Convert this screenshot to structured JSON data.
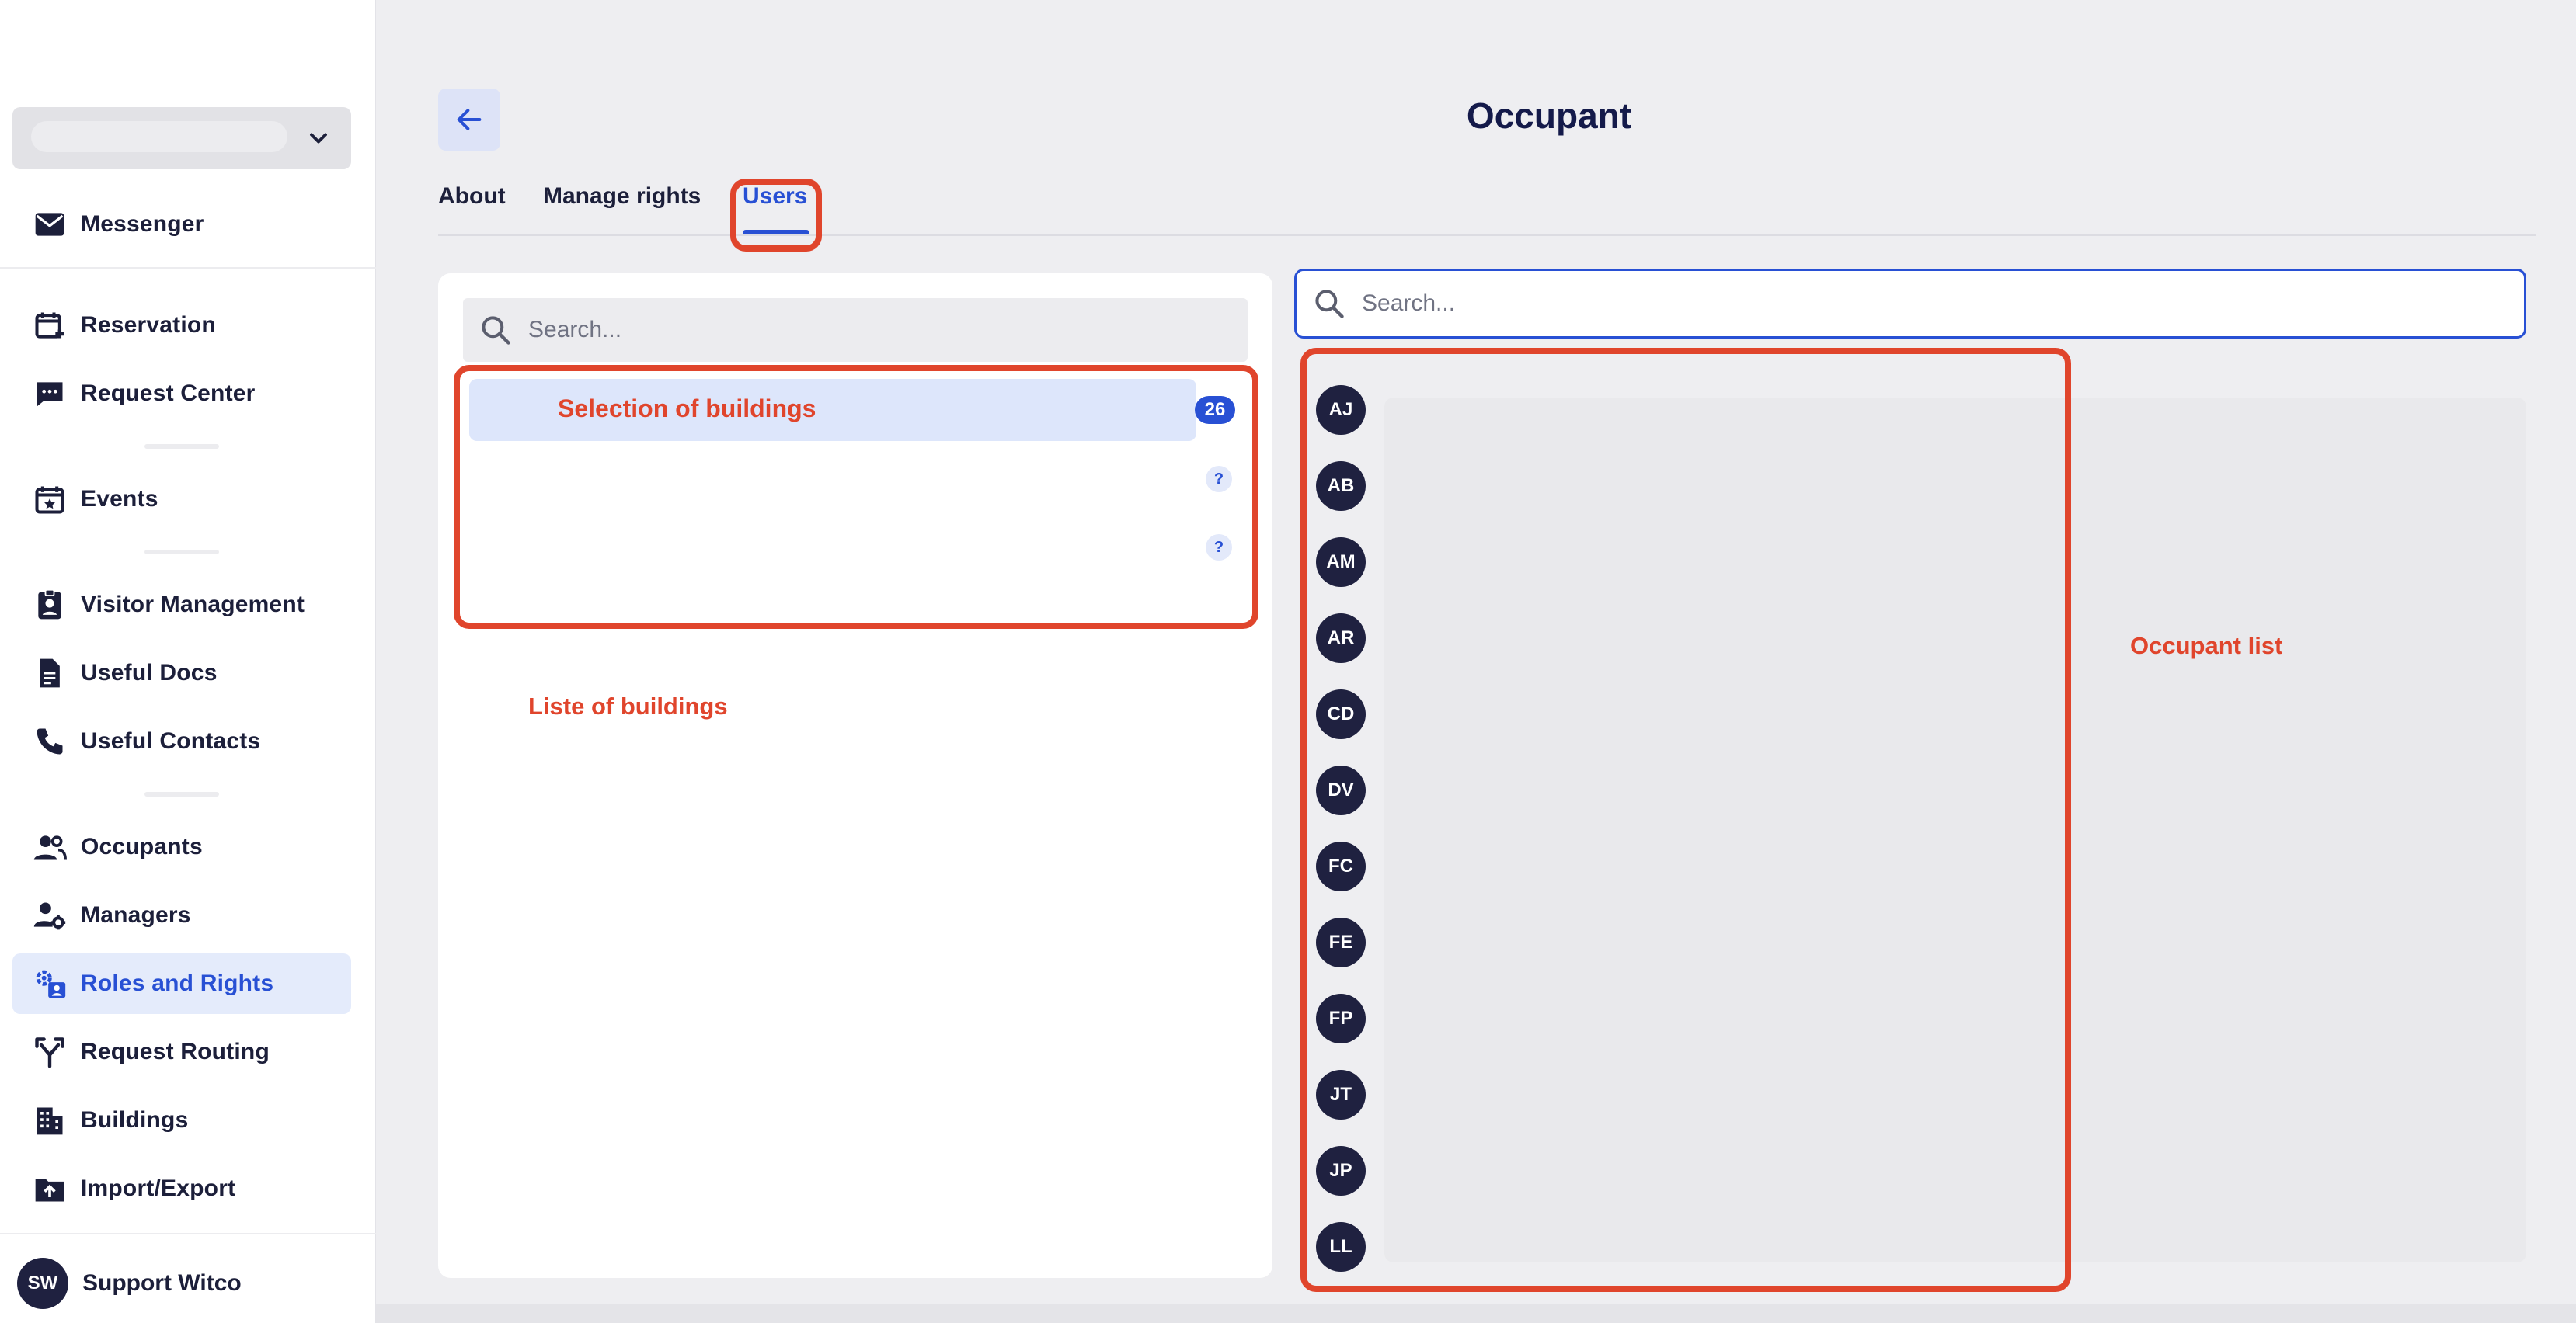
{
  "sidebar": {
    "items": [
      {
        "label": "Messenger",
        "icon": "mail-icon"
      },
      {
        "label": "Reservation",
        "icon": "calendar-plus-icon"
      },
      {
        "label": "Request Center",
        "icon": "chat-icon"
      },
      {
        "label": "Events",
        "icon": "calendar-star-icon"
      },
      {
        "label": "Visitor Management",
        "icon": "badge-icon"
      },
      {
        "label": "Useful Docs",
        "icon": "document-icon"
      },
      {
        "label": "Useful Contacts",
        "icon": "phone-icon"
      },
      {
        "label": "Occupants",
        "icon": "people-icon"
      },
      {
        "label": "Managers",
        "icon": "user-gear-icon"
      },
      {
        "label": "Roles and Rights",
        "icon": "roles-icon",
        "active": true
      },
      {
        "label": "Request Routing",
        "icon": "routing-icon"
      },
      {
        "label": "Buildings",
        "icon": "building-icon"
      },
      {
        "label": "Import/Export",
        "icon": "upload-folder-icon"
      }
    ],
    "user": {
      "initials": "SW",
      "name": "Support Witco"
    }
  },
  "header": {
    "title": "Occupant"
  },
  "tabs": [
    {
      "label": "About"
    },
    {
      "label": "Manage rights"
    },
    {
      "label": "Users",
      "active": true
    }
  ],
  "buildings": {
    "search_placeholder": "Search...",
    "selection_label": "Selection of buildings",
    "selection_count": "26",
    "rows": [
      {
        "badge": "?"
      },
      {
        "badge": "?"
      }
    ],
    "annotation": "Liste of buildings"
  },
  "occupants": {
    "search_placeholder": "Search...",
    "initials": [
      "AJ",
      "AB",
      "AM",
      "AR",
      "CD",
      "DV",
      "FC",
      "FE",
      "FP",
      "JT",
      "JP",
      "LL"
    ],
    "annotation": "Occupant list"
  },
  "colors": {
    "accent": "#2850d4",
    "annotation": "#e0452c",
    "avatar": "#1f2140"
  }
}
